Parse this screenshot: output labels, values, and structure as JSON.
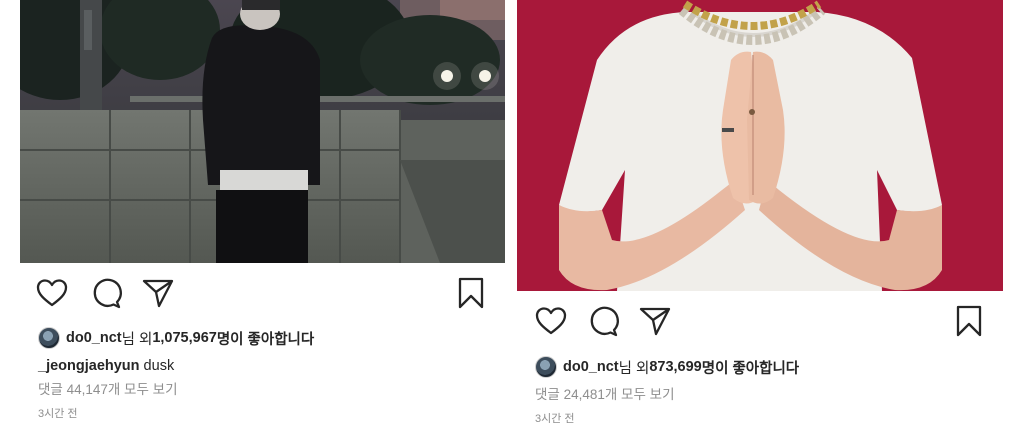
{
  "posts": [
    {
      "liked_by_user": "do0_nct",
      "likes_prefix": "님 외 ",
      "likes_count": "1,075,967",
      "likes_suffix": "명이 좋아합니다",
      "caption_user": "_jeongjaehyun",
      "caption_text": " dusk",
      "comments_prefix": "댓글 ",
      "comments_count": "44,147",
      "comments_suffix": "개 모두 보기",
      "time_ago": "3시간 전"
    },
    {
      "liked_by_user": "do0_nct",
      "likes_prefix": "님 외 ",
      "likes_count": "873,699",
      "likes_suffix": "명이 좋아합니다",
      "comments_prefix": "댓글 ",
      "comments_count": "24,481",
      "comments_suffix": "개 모두 보기",
      "time_ago": "3시간 전"
    }
  ],
  "icons": [
    "heart-icon",
    "comment-icon",
    "share-icon",
    "bookmark-icon"
  ],
  "colors": {
    "text": "#262626",
    "muted": "#8e8e8e",
    "right_photo_background": "#a8183a"
  }
}
